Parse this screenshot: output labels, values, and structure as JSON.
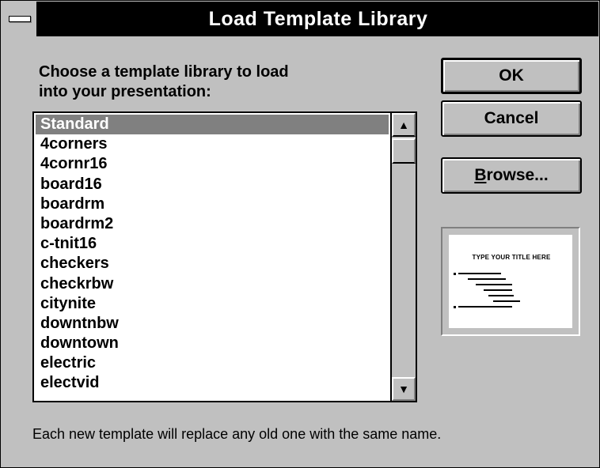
{
  "window": {
    "title": "Load Template Library"
  },
  "prompt": {
    "line1": "Choose a template library to load",
    "line2": "into your presentation:"
  },
  "list": {
    "items": [
      "Standard",
      "4corners",
      "4cornr16",
      "board16",
      "boardrm",
      "boardrm2",
      "c-tnit16",
      "checkers",
      "checkrbw",
      "citynite",
      "downtnbw",
      "downtown",
      "electric",
      "electvid"
    ],
    "selected_index": 0
  },
  "buttons": {
    "ok": "OK",
    "cancel": "Cancel",
    "browse_mnemonic": "B",
    "browse_rest": "rowse..."
  },
  "preview": {
    "title": "TYPE YOUR TITLE HERE"
  },
  "footer": {
    "note": "Each new template will replace any old one with the same name."
  },
  "colors": {
    "face": "#c0c0c0",
    "titlebar": "#000000",
    "selection": "#808080"
  },
  "icons": {
    "system_menu": "system-menu-icon",
    "scroll_up": "arrow-up-icon",
    "scroll_down": "arrow-down-icon"
  }
}
